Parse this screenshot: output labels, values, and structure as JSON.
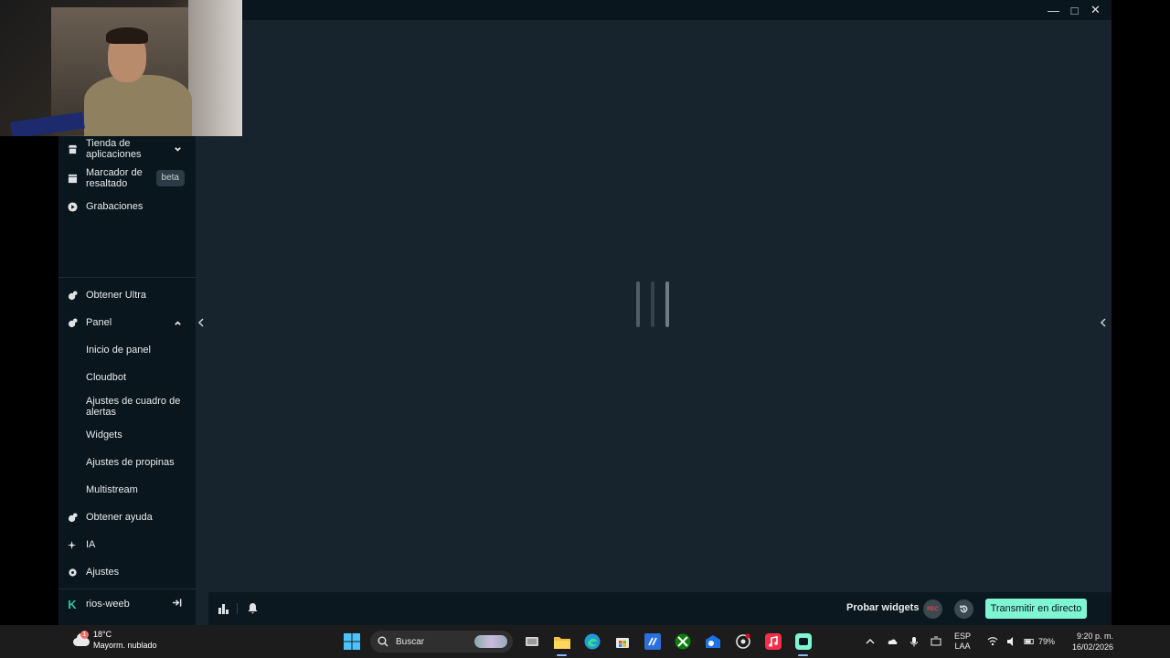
{
  "window": {
    "controls": [
      "minimize",
      "maximize",
      "close"
    ]
  },
  "sidebar": {
    "items": [
      {
        "label": "Tienda de aplicaciones",
        "icon": "store-icon",
        "chevron": "down"
      },
      {
        "label": "Marcador de resaltado",
        "icon": "clapperboard-icon",
        "badge": "beta"
      },
      {
        "label": "Grabaciones",
        "icon": "play-circle-icon"
      },
      {
        "label": "Obtener Ultra",
        "icon": "ultra-icon"
      },
      {
        "label": "Panel",
        "icon": "panel-icon",
        "chevron": "up"
      },
      {
        "label": "Inicio de panel"
      },
      {
        "label": "Cloudbot"
      },
      {
        "label": "Ajustes de cuadro de alertas"
      },
      {
        "label": "Widgets"
      },
      {
        "label": "Ajustes de propinas"
      },
      {
        "label": "Multistream"
      },
      {
        "label": "Obtener ayuda",
        "icon": "help-icon"
      },
      {
        "label": "IA",
        "icon": "sparkle-icon"
      },
      {
        "label": "Ajustes",
        "icon": "gear-icon"
      }
    ],
    "user": {
      "name": "rios-weeb",
      "logo": "K"
    }
  },
  "footer": {
    "probar_label": "Probar widgets",
    "rec_label": "REC",
    "golive_label": "Transmitir en directo"
  },
  "taskbar": {
    "weather": {
      "temp": "18°C",
      "desc": "Mayorm. nublado",
      "alert": "1"
    },
    "search_placeholder": "Buscar",
    "lang_1": "ESP",
    "lang_2": "LAA",
    "battery": "79%",
    "time": "9:20 p. m.",
    "date": "16/02/2026"
  },
  "colors": {
    "app_bg": "#17242d",
    "sidebar_bg": "#09161d",
    "accent": "#80f5d2",
    "streamlabs_green": "#31c3a2"
  }
}
